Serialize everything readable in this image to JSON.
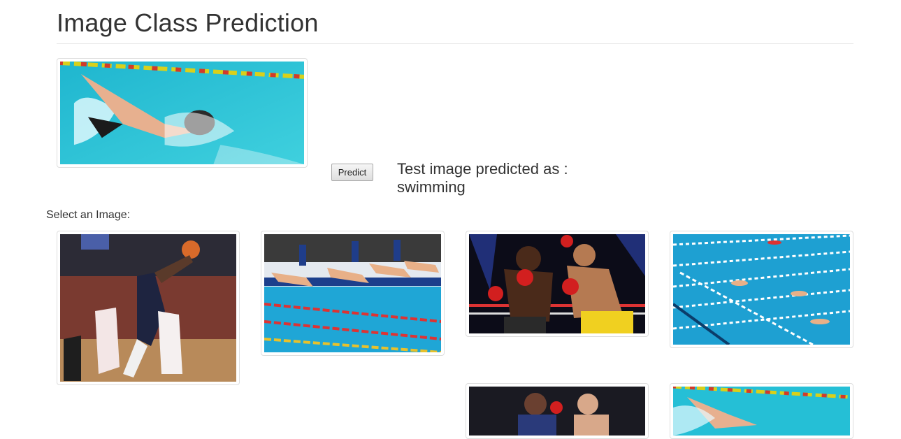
{
  "header": {
    "title": "Image Class Prediction"
  },
  "test_image": {
    "icon": "swimmer-photo",
    "alt": "test image"
  },
  "predict_button": {
    "label": "Predict"
  },
  "result": {
    "prefix": "Test image predicted as :",
    "value": "swimming"
  },
  "gallery": {
    "label": "Select an Image:",
    "images": [
      {
        "icon": "basketball-photo"
      },
      {
        "icon": "swim-race-start-photo"
      },
      {
        "icon": "boxing-photo"
      },
      {
        "icon": "swimming-pool-photo"
      },
      {
        "icon": "boxing-photo-2"
      },
      {
        "icon": "swimmer-photo"
      }
    ]
  },
  "colors": {
    "pool": "#25bfd6",
    "text": "#333333",
    "border": "#dddddd"
  }
}
